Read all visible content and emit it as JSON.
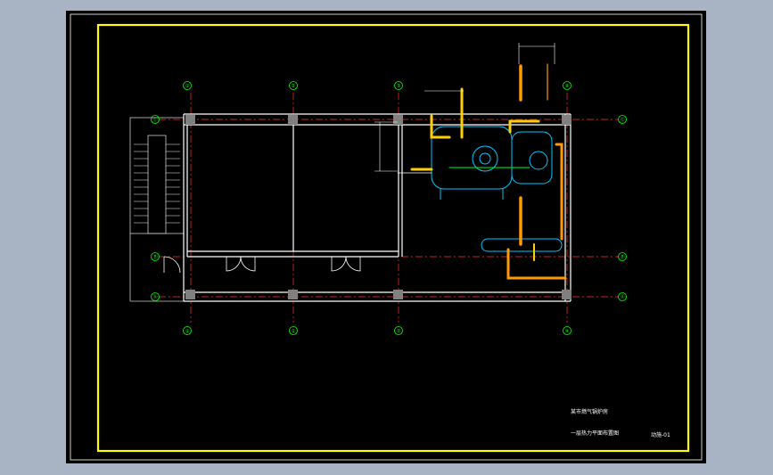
{
  "grid": {
    "columns": [
      "①",
      "②",
      "③",
      "④"
    ],
    "rows_right": [
      "Ⓒ",
      "Ⓑ",
      "Ⓐ"
    ],
    "rows_left": [
      "Ⓒ",
      "Ⓑ",
      "Ⓐ"
    ]
  },
  "title_block": {
    "project": "某市燃气锅炉房",
    "drawing_title": "一层热力平面布置图",
    "drawing_no": "动施-01"
  },
  "colors": {
    "sheet_bg": "#000000",
    "frame": "#ffff00",
    "wall": "#ffffff",
    "axis": "#ff3030",
    "axis_bubble": "#00ff00",
    "pipe_hot": "#ffd000",
    "pipe_orange": "#ff9a00",
    "equipment": "#00c8ff",
    "column": "#808080"
  },
  "icons": {
    "door_swing": "door-swing-icon",
    "stair": "stair-icon"
  }
}
